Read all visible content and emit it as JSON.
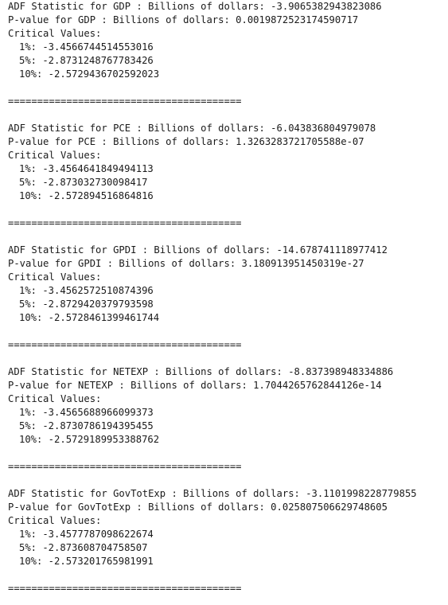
{
  "results": [
    {
      "adf_line": "ADF Statistic for GDP : Billions of dollars: -3.9065382943823086",
      "pvalue_line": "P-value for GDP : Billions of dollars: 0.0019872523174590717",
      "critical_header": "Critical Values:",
      "critical": [
        "1%: -3.4566744514553016",
        "5%: -2.8731248767783426",
        "10%: -2.5729436702592023"
      ],
      "separator": "========================================"
    },
    {
      "adf_line": "ADF Statistic for PCE : Billions of dollars: -6.043836804979078",
      "pvalue_line": "P-value for PCE : Billions of dollars: 1.3263283721705588e-07",
      "critical_header": "Critical Values:",
      "critical": [
        "1%: -3.4564641849494113",
        "5%: -2.873032730098417",
        "10%: -2.572894516864816"
      ],
      "separator": "========================================"
    },
    {
      "adf_line": "ADF Statistic for GPDI : Billions of dollars: -14.678741118977412",
      "pvalue_line": "P-value for GPDI : Billions of dollars: 3.180913951450319e-27",
      "critical_header": "Critical Values:",
      "critical": [
        "1%: -3.4562572510874396",
        "5%: -2.8729420379793598",
        "10%: -2.5728461399461744"
      ],
      "separator": "========================================"
    },
    {
      "adf_line": "ADF Statistic for NETEXP : Billions of dollars: -8.837398948334886",
      "pvalue_line": "P-value for NETEXP : Billions of dollars: 1.7044265762844126e-14",
      "critical_header": "Critical Values:",
      "critical": [
        "1%: -3.4565688966099373",
        "5%: -2.8730786194395455",
        "10%: -2.5729189953388762"
      ],
      "separator": "========================================"
    },
    {
      "adf_line": "ADF Statistic for GovTotExp : Billions of dollars: -3.1101998228779855",
      "pvalue_line": "P-value for GovTotExp : Billions of dollars: 0.025807506629748605",
      "critical_header": "Critical Values:",
      "critical": [
        "1%: -3.4577787098622674",
        "5%: -2.873608704758507",
        "10%: -2.573201765981991"
      ],
      "separator": "========================================"
    }
  ]
}
